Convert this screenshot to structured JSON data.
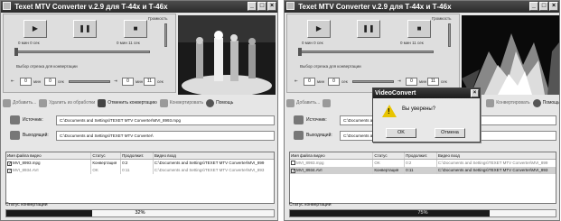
{
  "left": {
    "title": "Texet MTV Converter v.2.9 для Т-44х и Т-46х",
    "player": {
      "time_start": "0 мин 0 сек",
      "time_end": "0 мин 11 сек",
      "volume_label": "Громкость",
      "range_label": "Выбор отрезка для конвертации",
      "from_min": "0",
      "from_sec": "0",
      "to_min": "0",
      "to_sec": "11",
      "min_unit": "мин",
      "sec_unit": "сек"
    },
    "toolbar": {
      "add": "Добавить...",
      "remove": "Удалить из обработки",
      "cancel": "Отменить конвертацию",
      "convert": "Конвертировать",
      "help": "Помощь"
    },
    "source_label": "Источник:",
    "source_path": "C:\\Documents and Settings\\TEXET MTV Converter\\MVI_8993.mpg",
    "output_label": "Выходящий:",
    "output_path": "C:\\Documents and Settings\\TEXET MTV Converter\\",
    "table": {
      "headers": [
        "Имя файла видео",
        "Статус",
        "Продолжит.",
        "Видео вход"
      ],
      "rows": [
        {
          "checked": true,
          "name": "MVI_8993.mpg",
          "status": "Конвертация",
          "duration": "0:2",
          "path": "C:\\Documents and Settings\\TEXET MTV Converter\\MVI_899"
        },
        {
          "checked": true,
          "name": "MVI_8934.AVI",
          "status": "OK",
          "duration": "0:11",
          "path": "C:\\Documents and Settings\\TEXET MTV Converter\\MVI_893"
        }
      ]
    },
    "status_label": "Статус конвертации",
    "progress_text": "32%",
    "progress_value": 0.32
  },
  "right": {
    "title": "Texet MTV Converter v.2.9 для Т-44х и Т-46х",
    "player": {
      "time_start": "0 мин 0 сек",
      "time_end": "0 мин 11 сек",
      "volume_label": "Громкость",
      "range_label": "Выбор отрезка для конвертации",
      "from_min": "0",
      "from_sec": "0",
      "to_min": "0",
      "to_sec": "11",
      "min_unit": "мин",
      "sec_unit": "сек"
    },
    "toolbar": {
      "add": "Добавить...",
      "convert": "Конвертировать",
      "help": "Помощь"
    },
    "source_label": "Источник:",
    "source_path": "C:\\Documents and Settings\\TEXET MTV Converter\\MVI_8934.AVI",
    "output_label": "Выходящий:",
    "output_path": "C:\\Documents and Settings\\TEXET MTV Converter\\",
    "table": {
      "headers": [
        "Имя файла видео",
        "Статус",
        "Продолжит.",
        "Видео вход"
      ],
      "rows": [
        {
          "checked": false,
          "name": "MVI_8993.mpg",
          "status": "OK",
          "duration": "0:2",
          "path": "C:\\Documents and Settings\\TEXET MTV Converter\\MVI_899"
        },
        {
          "checked": true,
          "name": "MVI_8934.AVI",
          "status": "Конвертация",
          "duration": "0:11",
          "path": "C:\\Documents and Settings\\TEXET MTV Converter\\MVI_893"
        }
      ]
    },
    "status_label": "Статус конвертации",
    "progress_text": "75%",
    "progress_value": 0.75,
    "dialog": {
      "title": "VideoConvert",
      "message": "Вы уверены?",
      "ok": "OK",
      "cancel": "Отмена"
    }
  }
}
